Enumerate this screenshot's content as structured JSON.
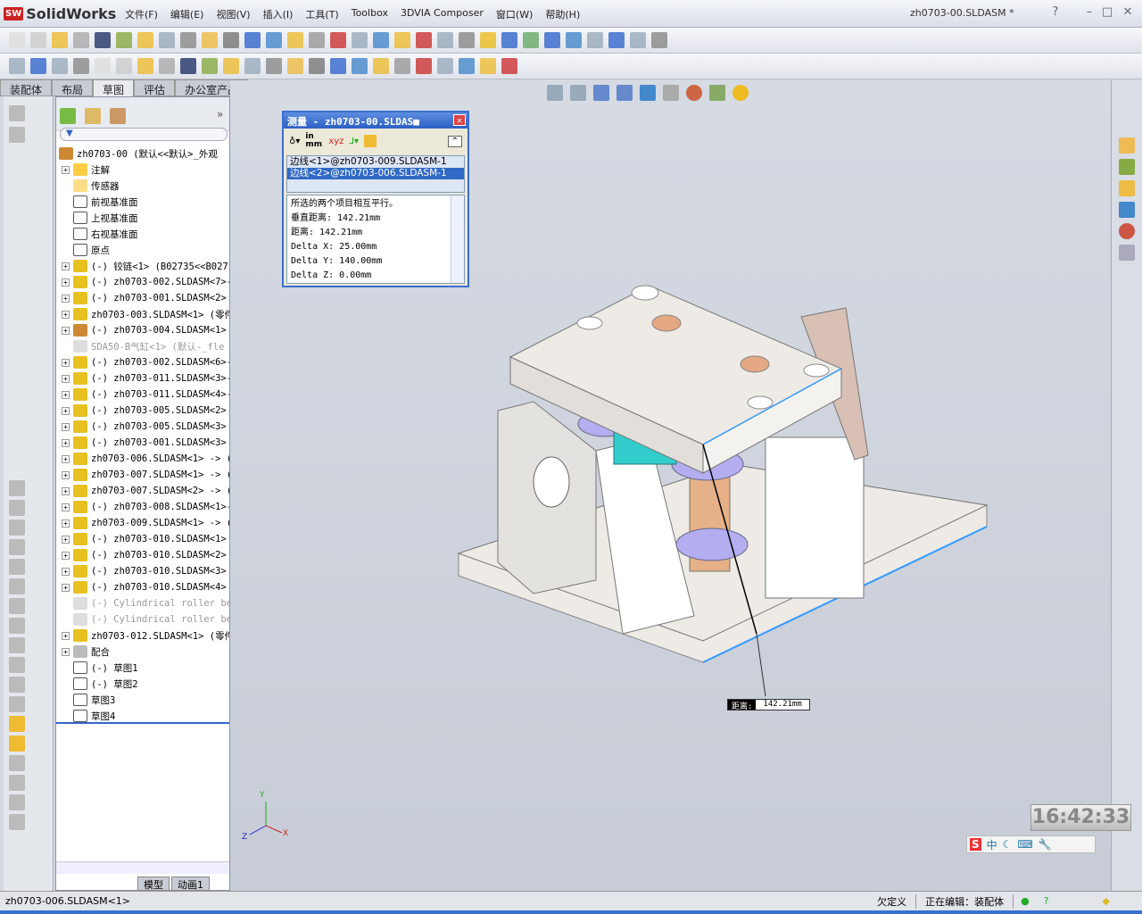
{
  "app": {
    "name": "SolidWorks",
    "doc_title": "zh0703-00.SLDASM *"
  },
  "menu": [
    "文件(F)",
    "编辑(E)",
    "视图(V)",
    "插入(I)",
    "工具(T)",
    "Toolbox",
    "3DVIA Composer",
    "窗口(W)",
    "帮助(H)"
  ],
  "tabs": [
    {
      "label": "装配体"
    },
    {
      "label": "布局"
    },
    {
      "label": "草图",
      "active": true
    },
    {
      "label": "评估"
    },
    {
      "label": "办公室产品"
    }
  ],
  "tree": {
    "root": "zh0703-00  (默认<<默认>_外观",
    "items": [
      {
        "label": "注解",
        "expand": true,
        "icon": "annotation"
      },
      {
        "label": "传感器",
        "expand": false,
        "icon": "sensor"
      },
      {
        "label": "前视基准面",
        "expand": false,
        "icon": "plane"
      },
      {
        "label": "上视基准面",
        "expand": false,
        "icon": "plane"
      },
      {
        "label": "右视基准面",
        "expand": false,
        "icon": "plane"
      },
      {
        "label": "原点",
        "expand": false,
        "icon": "origin"
      },
      {
        "label": "(-) 铰链<1> (B02735<<B027:",
        "expand": true,
        "icon": "assembly"
      },
      {
        "label": "(-) zh0703-002.SLDASM<7>-",
        "expand": true,
        "icon": "assembly"
      },
      {
        "label": "(-) zh0703-001.SLDASM<2>",
        "expand": true,
        "icon": "assembly"
      },
      {
        "label": "zh0703-003.SLDASM<1> (零件",
        "expand": true,
        "icon": "assembly"
      },
      {
        "label": "(-) zh0703-004.SLDASM<1>",
        "expand": true,
        "icon": "assembly-traffic"
      },
      {
        "label": "SDA50-B气缸<1> (默认-_fle",
        "expand": false,
        "icon": "suppressed",
        "dim": true
      },
      {
        "label": "(-) zh0703-002.SLDASM<6>-",
        "expand": true,
        "icon": "assembly"
      },
      {
        "label": "(-) zh0703-011.SLDASM<3>-",
        "expand": true,
        "icon": "assembly"
      },
      {
        "label": "(-) zh0703-011.SLDASM<4>-",
        "expand": true,
        "icon": "assembly"
      },
      {
        "label": "(-) zh0703-005.SLDASM<2>",
        "expand": true,
        "icon": "assembly"
      },
      {
        "label": "(-) zh0703-005.SLDASM<3>",
        "expand": true,
        "icon": "assembly"
      },
      {
        "label": "(-) zh0703-001.SLDASM<3>",
        "expand": true,
        "icon": "assembly"
      },
      {
        "label": "zh0703-006.SLDASM<1> -> (",
        "expand": true,
        "icon": "assembly"
      },
      {
        "label": "zh0703-007.SLDASM<1> -> (",
        "expand": true,
        "icon": "assembly"
      },
      {
        "label": "zh0703-007.SLDASM<2> -> (",
        "expand": true,
        "icon": "assembly"
      },
      {
        "label": "(-) zh0703-008.SLDASM<1>-",
        "expand": true,
        "icon": "assembly"
      },
      {
        "label": "zh0703-009.SLDASM<1> -> (",
        "expand": true,
        "icon": "assembly"
      },
      {
        "label": "(-) zh0703-010.SLDASM<1>",
        "expand": true,
        "icon": "assembly"
      },
      {
        "label": "(-) zh0703-010.SLDASM<2>",
        "expand": true,
        "icon": "assembly"
      },
      {
        "label": "(-) zh0703-010.SLDASM<3>",
        "expand": true,
        "icon": "assembly"
      },
      {
        "label": "(-) zh0703-010.SLDASM<4>",
        "expand": true,
        "icon": "assembly"
      },
      {
        "label": "(-) Cylindrical roller be",
        "expand": false,
        "icon": "suppressed",
        "dim": true
      },
      {
        "label": "(-) Cylindrical roller be",
        "expand": false,
        "icon": "suppressed",
        "dim": true
      },
      {
        "label": "zh0703-012.SLDASM<1> (零件",
        "expand": true,
        "icon": "assembly"
      },
      {
        "label": "配合",
        "expand": true,
        "icon": "mates"
      },
      {
        "label": "(-) 草图1",
        "expand": false,
        "icon": "sketch"
      },
      {
        "label": "(-) 草图2",
        "expand": false,
        "icon": "sketch"
      },
      {
        "label": "草图3",
        "expand": false,
        "icon": "sketch"
      },
      {
        "label": "草图4",
        "expand": false,
        "icon": "sketch"
      }
    ]
  },
  "measure": {
    "title": "测量 - zh0703-00.SLDAS■",
    "units_label": "in mm",
    "selections": [
      {
        "label": "边线<1>@zh0703-009.SLDASM-1"
      },
      {
        "label": "边线<2>@zh0703-006.SLDASM-1",
        "selected": true
      }
    ],
    "results": [
      "所选的两个项目相互平行。",
      "垂直距离: 142.21mm",
      "距离: 142.21mm",
      "Delta X: 25.00mm",
      "Delta Y: 140.00mm",
      "Delta Z: 0.00mm"
    ]
  },
  "viewport": {
    "dist_key": "距离:",
    "dist_value": "142.21mm",
    "axis_x": "X",
    "axis_y": "Y",
    "axis_z": "Z"
  },
  "bottom_tabs": [
    "模型",
    "动画1"
  ],
  "clock": "16:42:33",
  "ime": {
    "label": "中"
  },
  "status": {
    "selected": "zh0703-006.SLDASM<1>",
    "define_state": "欠定义",
    "editing": "正在编辑：装配体"
  },
  "colors": {
    "accent": "#316ac5",
    "part_face": "#eeeae6",
    "bronze": "#e4b08a",
    "purple": "#b0a8e8",
    "cyan": "#3cc"
  }
}
